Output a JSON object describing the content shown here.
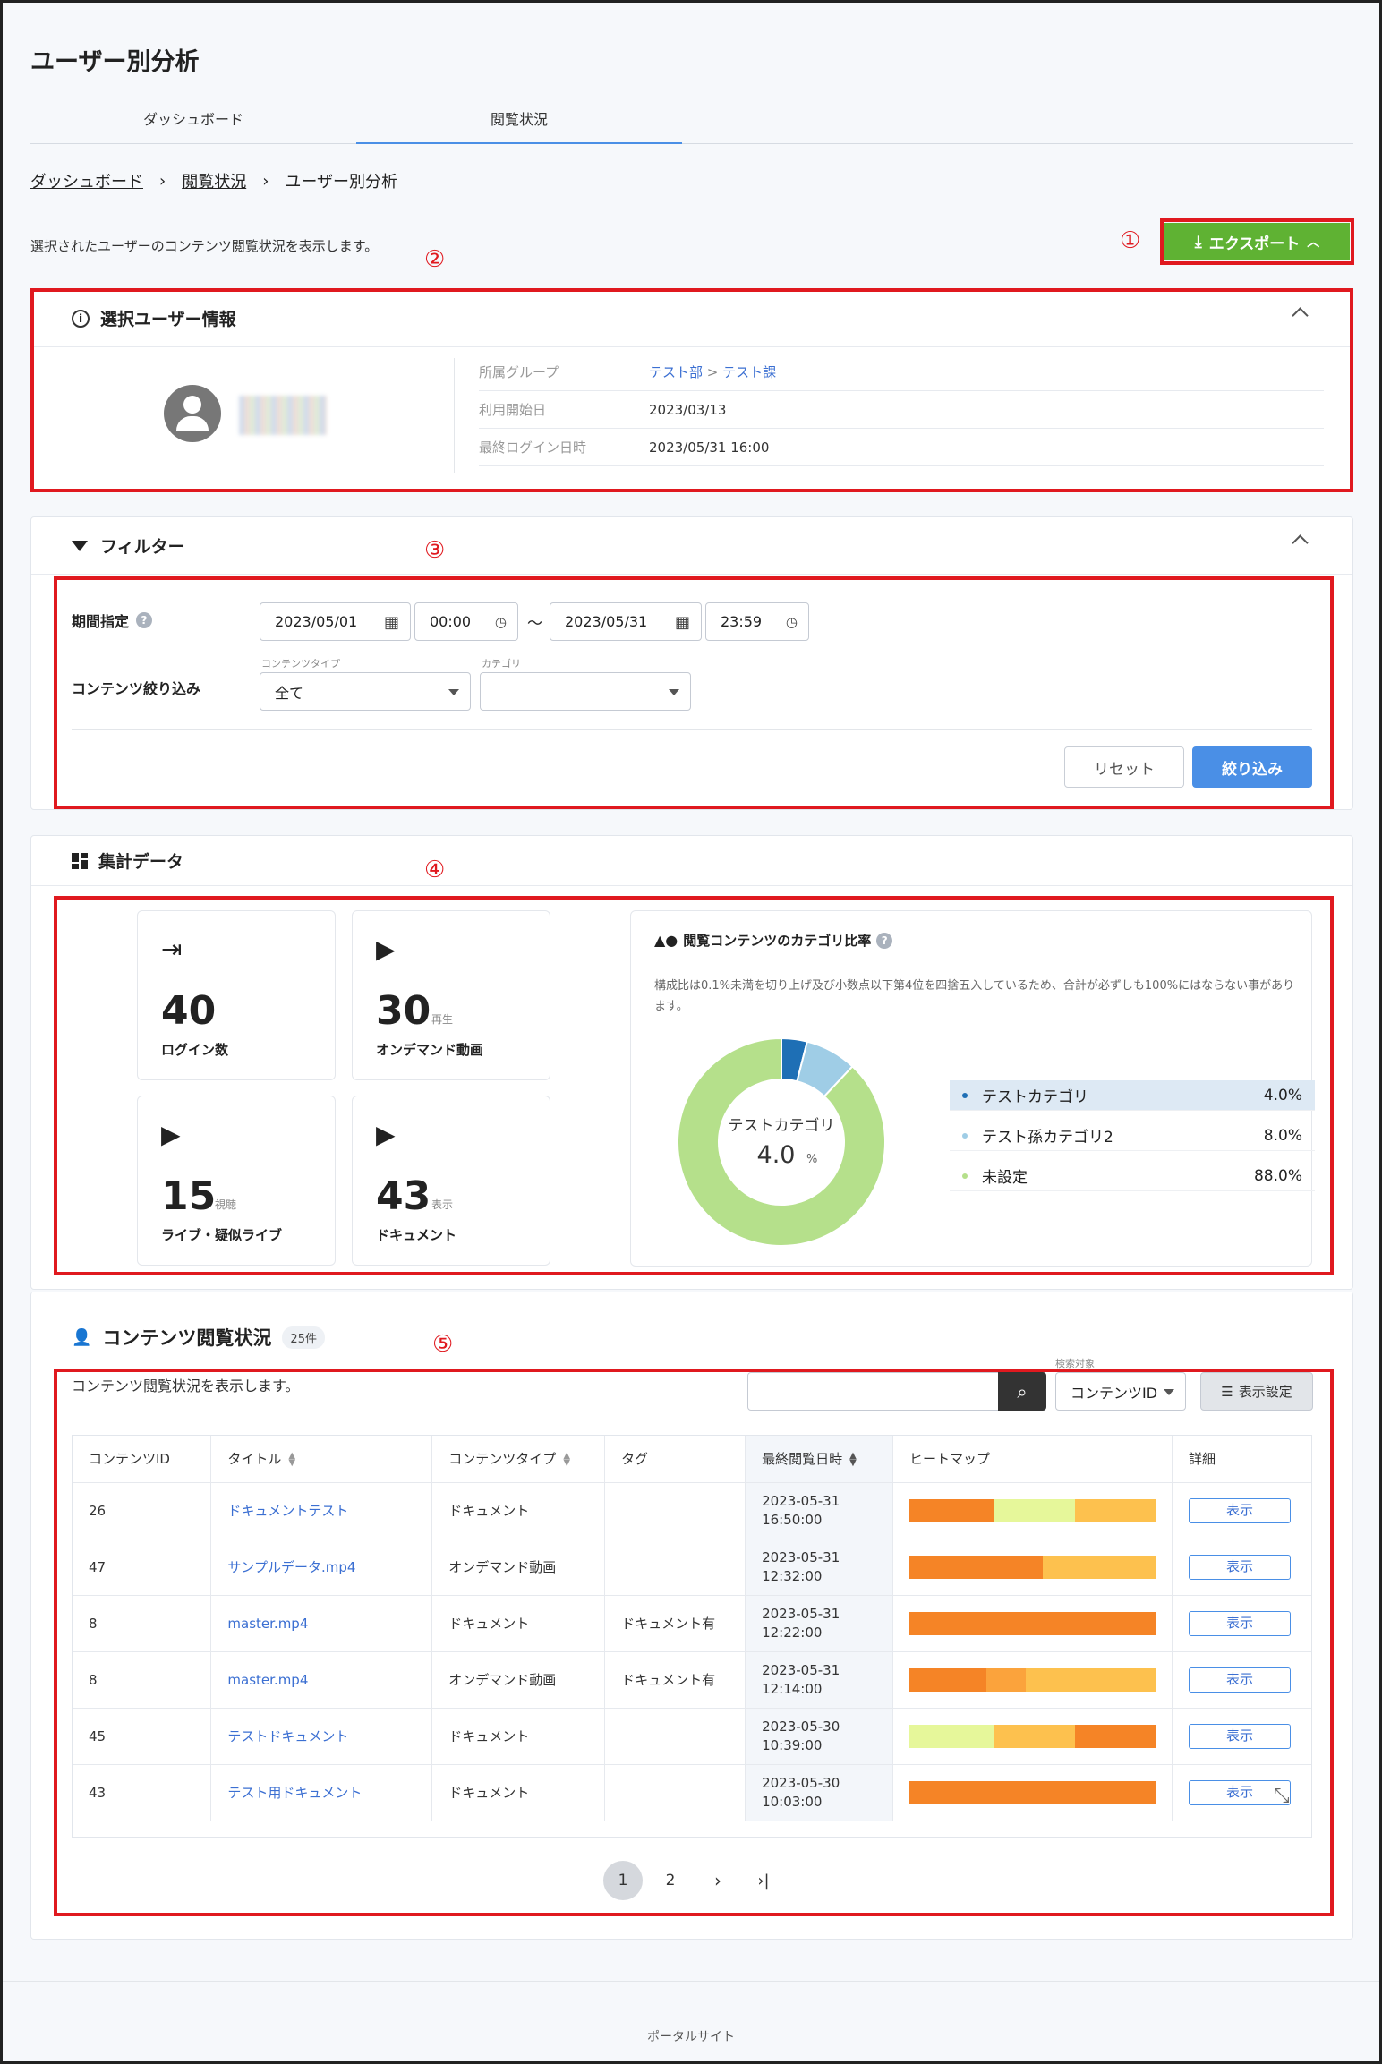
{
  "page": {
    "title": "ユーザー別分析",
    "description": "選択されたユーザーのコンテンツ閲覧状況を表示します。",
    "footer": "ポータルサイト"
  },
  "tabs": [
    {
      "label": "ダッシュボード"
    },
    {
      "label": "閲覧状況"
    }
  ],
  "breadcrumb": [
    {
      "label": "ダッシュボード"
    },
    {
      "label": "閲覧状況"
    },
    {
      "label": "ユーザー別分析"
    }
  ],
  "export_button": {
    "label": "エクスポート"
  },
  "annotations": [
    "①",
    "②",
    "③",
    "④",
    "⑤"
  ],
  "user_info": {
    "title": "選択ユーザー情報",
    "rows": [
      {
        "label": "所属グループ",
        "value1": "テスト部",
        "sep": " > ",
        "value2": "テスト課"
      },
      {
        "label": "利用開始日",
        "value": "2023/03/13"
      },
      {
        "label": "最終ログイン日時",
        "value": "2023/05/31 16:00"
      }
    ]
  },
  "filter": {
    "title": "フィルター",
    "period_label": "期間指定",
    "start_date": "2023/05/01",
    "start_time": "00:00",
    "tilde": "〜",
    "end_date": "2023/05/31",
    "end_time": "23:59",
    "content_filter_label": "コンテンツ絞り込み",
    "content_type_label": "コンテンツタイプ",
    "content_type_value": "全て",
    "category_label": "カテゴリ",
    "category_value": "",
    "reset_label": "リセット",
    "apply_label": "絞り込み"
  },
  "summary": {
    "title": "集計データ",
    "stats": [
      {
        "value": "40",
        "unit": "",
        "caption": "ログイン数",
        "icon": "login-icon"
      },
      {
        "value": "30",
        "unit": "再生",
        "caption": "オンデマンド動画",
        "icon": "play-icon"
      },
      {
        "value": "15",
        "unit": "視聴",
        "caption": "ライブ・疑似ライブ",
        "icon": "play-icon"
      },
      {
        "value": "43",
        "unit": "表示",
        "caption": "ドキュメント",
        "icon": "play-icon"
      }
    ],
    "pie_title": "閲覧コンテンツのカテゴリ比率",
    "pie_note": "構成比は0.1%未満を切り上げ及び小数点以下第4位を四捨五入しているため、合計が必ずしも100%にはならない事があります。",
    "center_label": "テストカテゴリ",
    "center_value": "4.0",
    "center_unit": "%"
  },
  "chart_data": {
    "type": "pie",
    "categories": [
      "テストカテゴリ",
      "テスト孫カテゴリ2",
      "未設定"
    ],
    "values": [
      4.0,
      8.0,
      88.0
    ],
    "value_labels": [
      "4.0%",
      "8.0%",
      "88.0%"
    ],
    "colors": [
      "#1e6fb5",
      "#9fcde6",
      "#b5e08b"
    ],
    "title": "閲覧コンテンツのカテゴリ比率"
  },
  "contents": {
    "title": "コンテンツ閲覧状況",
    "count": "25件",
    "description": "コンテンツ閲覧状況を表示します。",
    "search_target_label": "検索対象",
    "search_target_value": "コンテンツID",
    "display_settings": "表示設定",
    "columns": [
      "コンテンツID",
      "タイトル",
      "コンテンツタイプ",
      "タグ",
      "最終閲覧日時",
      "ヒートマップ",
      "詳細"
    ],
    "rows": [
      {
        "id": "26",
        "title": "ドキュメントテスト",
        "type": "ドキュメント",
        "tag": "",
        "date": "2023-05-31",
        "time": "16:50:00",
        "detail": "表示",
        "heat": [
          [
            0.34,
            "#f58426"
          ],
          [
            0.33,
            "#e6f79a"
          ],
          [
            0.33,
            "#fdc14e"
          ]
        ]
      },
      {
        "id": "47",
        "title": "サンプルデータ.mp4",
        "type": "オンデマンド動画",
        "tag": "",
        "date": "2023-05-31",
        "time": "12:32:00",
        "detail": "表示",
        "heat": [
          [
            0.54,
            "#f58426"
          ],
          [
            0.46,
            "#fdc14e"
          ]
        ]
      },
      {
        "id": "8",
        "title": "master.mp4",
        "type": "ドキュメント",
        "tag": "ドキュメント有",
        "date": "2023-05-31",
        "time": "12:22:00",
        "detail": "表示",
        "heat": [
          [
            1.0,
            "#f58426"
          ]
        ]
      },
      {
        "id": "8",
        "title": "master.mp4",
        "type": "オンデマンド動画",
        "tag": "ドキュメント有",
        "date": "2023-05-31",
        "time": "12:14:00",
        "detail": "表示",
        "heat": [
          [
            0.31,
            "#f58426"
          ],
          [
            0.16,
            "#fba33c"
          ],
          [
            0.53,
            "#fdc14e"
          ]
        ]
      },
      {
        "id": "45",
        "title": "テストドキュメント",
        "type": "ドキュメント",
        "tag": "",
        "date": "2023-05-30",
        "time": "10:39:00",
        "detail": "表示",
        "heat": [
          [
            0.34,
            "#e6f79a"
          ],
          [
            0.33,
            "#fdc14e"
          ],
          [
            0.33,
            "#f58426"
          ]
        ]
      },
      {
        "id": "43",
        "title": "テスト用ドキュメント",
        "type": "ドキュメント",
        "tag": "",
        "date": "2023-05-30",
        "time": "10:03:00",
        "detail": "表示",
        "heat": [
          [
            1.0,
            "#f58426"
          ]
        ]
      }
    ],
    "pagination": [
      "1",
      "2"
    ]
  },
  "colors": {
    "accent": "#4a8fe6",
    "export": "#5fb233",
    "annotation": "#e0191f",
    "link": "#3b6fd2"
  }
}
